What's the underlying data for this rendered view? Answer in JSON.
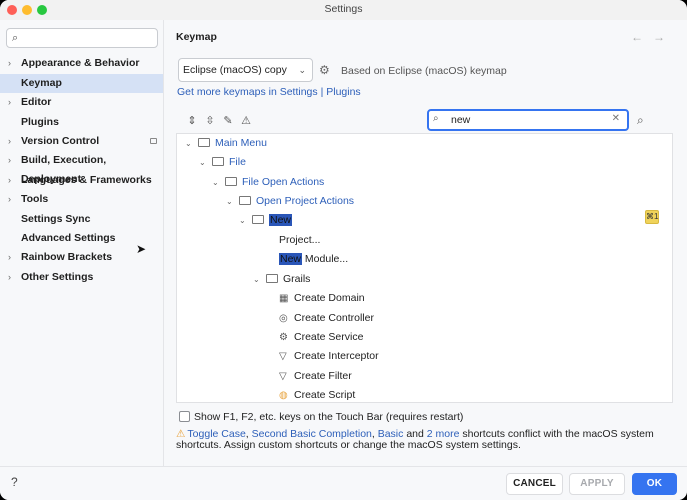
{
  "window": {
    "title": "Settings"
  },
  "sidebar": {
    "search_placeholder": "",
    "items": [
      {
        "label": "Appearance & Behavior",
        "expandable": true
      },
      {
        "label": "Keymap",
        "expandable": false,
        "selected": true
      },
      {
        "label": "Editor",
        "expandable": true
      },
      {
        "label": "Plugins",
        "expandable": false
      },
      {
        "label": "Version Control",
        "expandable": true
      },
      {
        "label": "Build, Execution, Deployment",
        "expandable": true
      },
      {
        "label": "Languages & Frameworks",
        "expandable": true
      },
      {
        "label": "Tools",
        "expandable": true
      },
      {
        "label": "Settings Sync",
        "expandable": false
      },
      {
        "label": "Advanced Settings",
        "expandable": false
      },
      {
        "label": "Rainbow Brackets",
        "expandable": true
      },
      {
        "label": "Other Settings",
        "expandable": true
      }
    ]
  },
  "main": {
    "heading": "Keymap",
    "keymap_select": "Eclipse (macOS) copy",
    "based_on": "Based on Eclipse (macOS) keymap",
    "links": {
      "prefix": "Get more keymaps in Settings",
      "sep": "|",
      "plugins": "Plugins"
    },
    "filter": {
      "value": "new"
    },
    "tree": {
      "main_menu": "Main Menu",
      "file": "File",
      "file_open_actions": "File Open Actions",
      "open_project_actions": "Open Project Actions",
      "new": "New",
      "project": "Project...",
      "new_module_hl": "New",
      "new_module_rest": " Module...",
      "grails": "Grails",
      "create_domain": "Create Domain",
      "create_controller": "Create Controller",
      "create_service": "Create Service",
      "create_interceptor": "Create Interceptor",
      "create_filter": "Create Filter",
      "create_script": "Create Script",
      "shortcut": "⌘1"
    },
    "touchbar": "Show F1, F2, etc. keys on the Touch Bar (requires restart)",
    "warning": {
      "link1": "Toggle Case",
      "sep1": ", ",
      "link2": "Second Basic Completion",
      "sep2": ", ",
      "link3": "Basic",
      "and": " and ",
      "link4": "2 more",
      "text": " shortcuts conflict with the macOS system shortcuts. Assign custom shortcuts or change the macOS system settings."
    }
  },
  "footer": {
    "help": "?",
    "cancel": "CANCEL",
    "apply": "APPLY",
    "ok": "OK"
  },
  "colors": {
    "accent": "#3574f0",
    "link": "#2d5fb9",
    "selection": "#d5e1f5",
    "highlight": "#2a56b8"
  }
}
